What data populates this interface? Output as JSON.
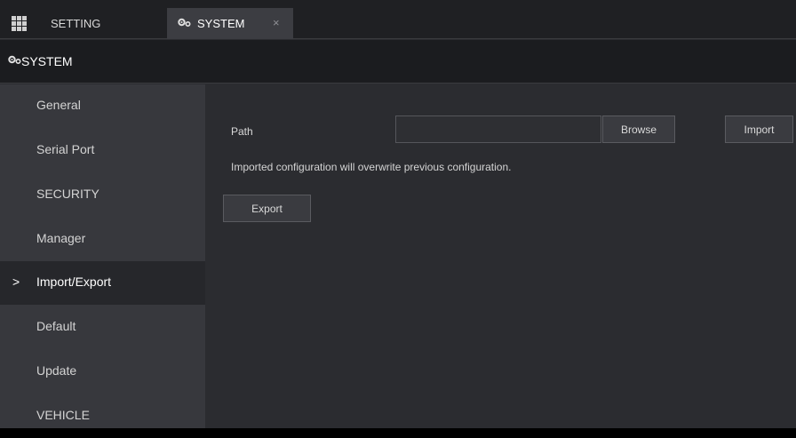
{
  "tabs": {
    "setting_label": "SETTING",
    "system_label": "SYSTEM",
    "close_glyph": "×"
  },
  "section": {
    "title": "SYSTEM"
  },
  "sidebar": {
    "active_marker": ">",
    "items": [
      {
        "label": "General"
      },
      {
        "label": "Serial Port"
      },
      {
        "label": "SECURITY"
      },
      {
        "label": "Manager"
      },
      {
        "label": "Import/Export",
        "active": true
      },
      {
        "label": "Default"
      },
      {
        "label": "Update"
      },
      {
        "label": "VEHICLE"
      }
    ]
  },
  "import_export": {
    "path_label": "Path",
    "path_value": "",
    "browse_label": "Browse",
    "import_label": "Import",
    "note": "Imported configuration will overwrite previous configuration.",
    "export_label": "Export"
  },
  "colors": {
    "tabbar_bg": "#1f2023",
    "header_bg": "#1b1c1f",
    "sidebar_bg": "#37383d",
    "sidebar_active_bg": "#26272b",
    "main_bg": "#2b2c30",
    "active_tab_bg": "#3c3d42"
  },
  "icons": {
    "menu": "grid-icon",
    "system": "gears-icon",
    "close": "close-icon",
    "active_marker": "chevron-right-icon"
  }
}
